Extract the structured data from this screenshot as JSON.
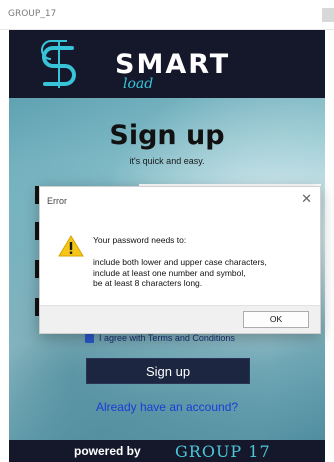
{
  "window": {
    "title": "GROUP_17"
  },
  "header": {
    "brand": "SMART",
    "brand_sub": "load"
  },
  "signup": {
    "heading": "Sign up",
    "subheading": "it's quick and easy.",
    "terms_label": "I agree with Terms and Conditions",
    "button_label": "Sign up",
    "login_link": "Already have an accound?"
  },
  "dialog": {
    "title": "Error",
    "close_glyph": "✕",
    "line1": "Your password needs to:",
    "body_lines": [
      "include both lower and upper case characters,",
      "include at least one number and symbol,",
      "be at least 8 characters long."
    ],
    "ok_label": "OK",
    "icon": "warning-icon"
  },
  "footer": {
    "powered": "powered by",
    "group": "GROUP 17"
  },
  "colors": {
    "header_bg": "#15182a",
    "accent": "#38c4d8",
    "link": "#1d3bd6"
  }
}
